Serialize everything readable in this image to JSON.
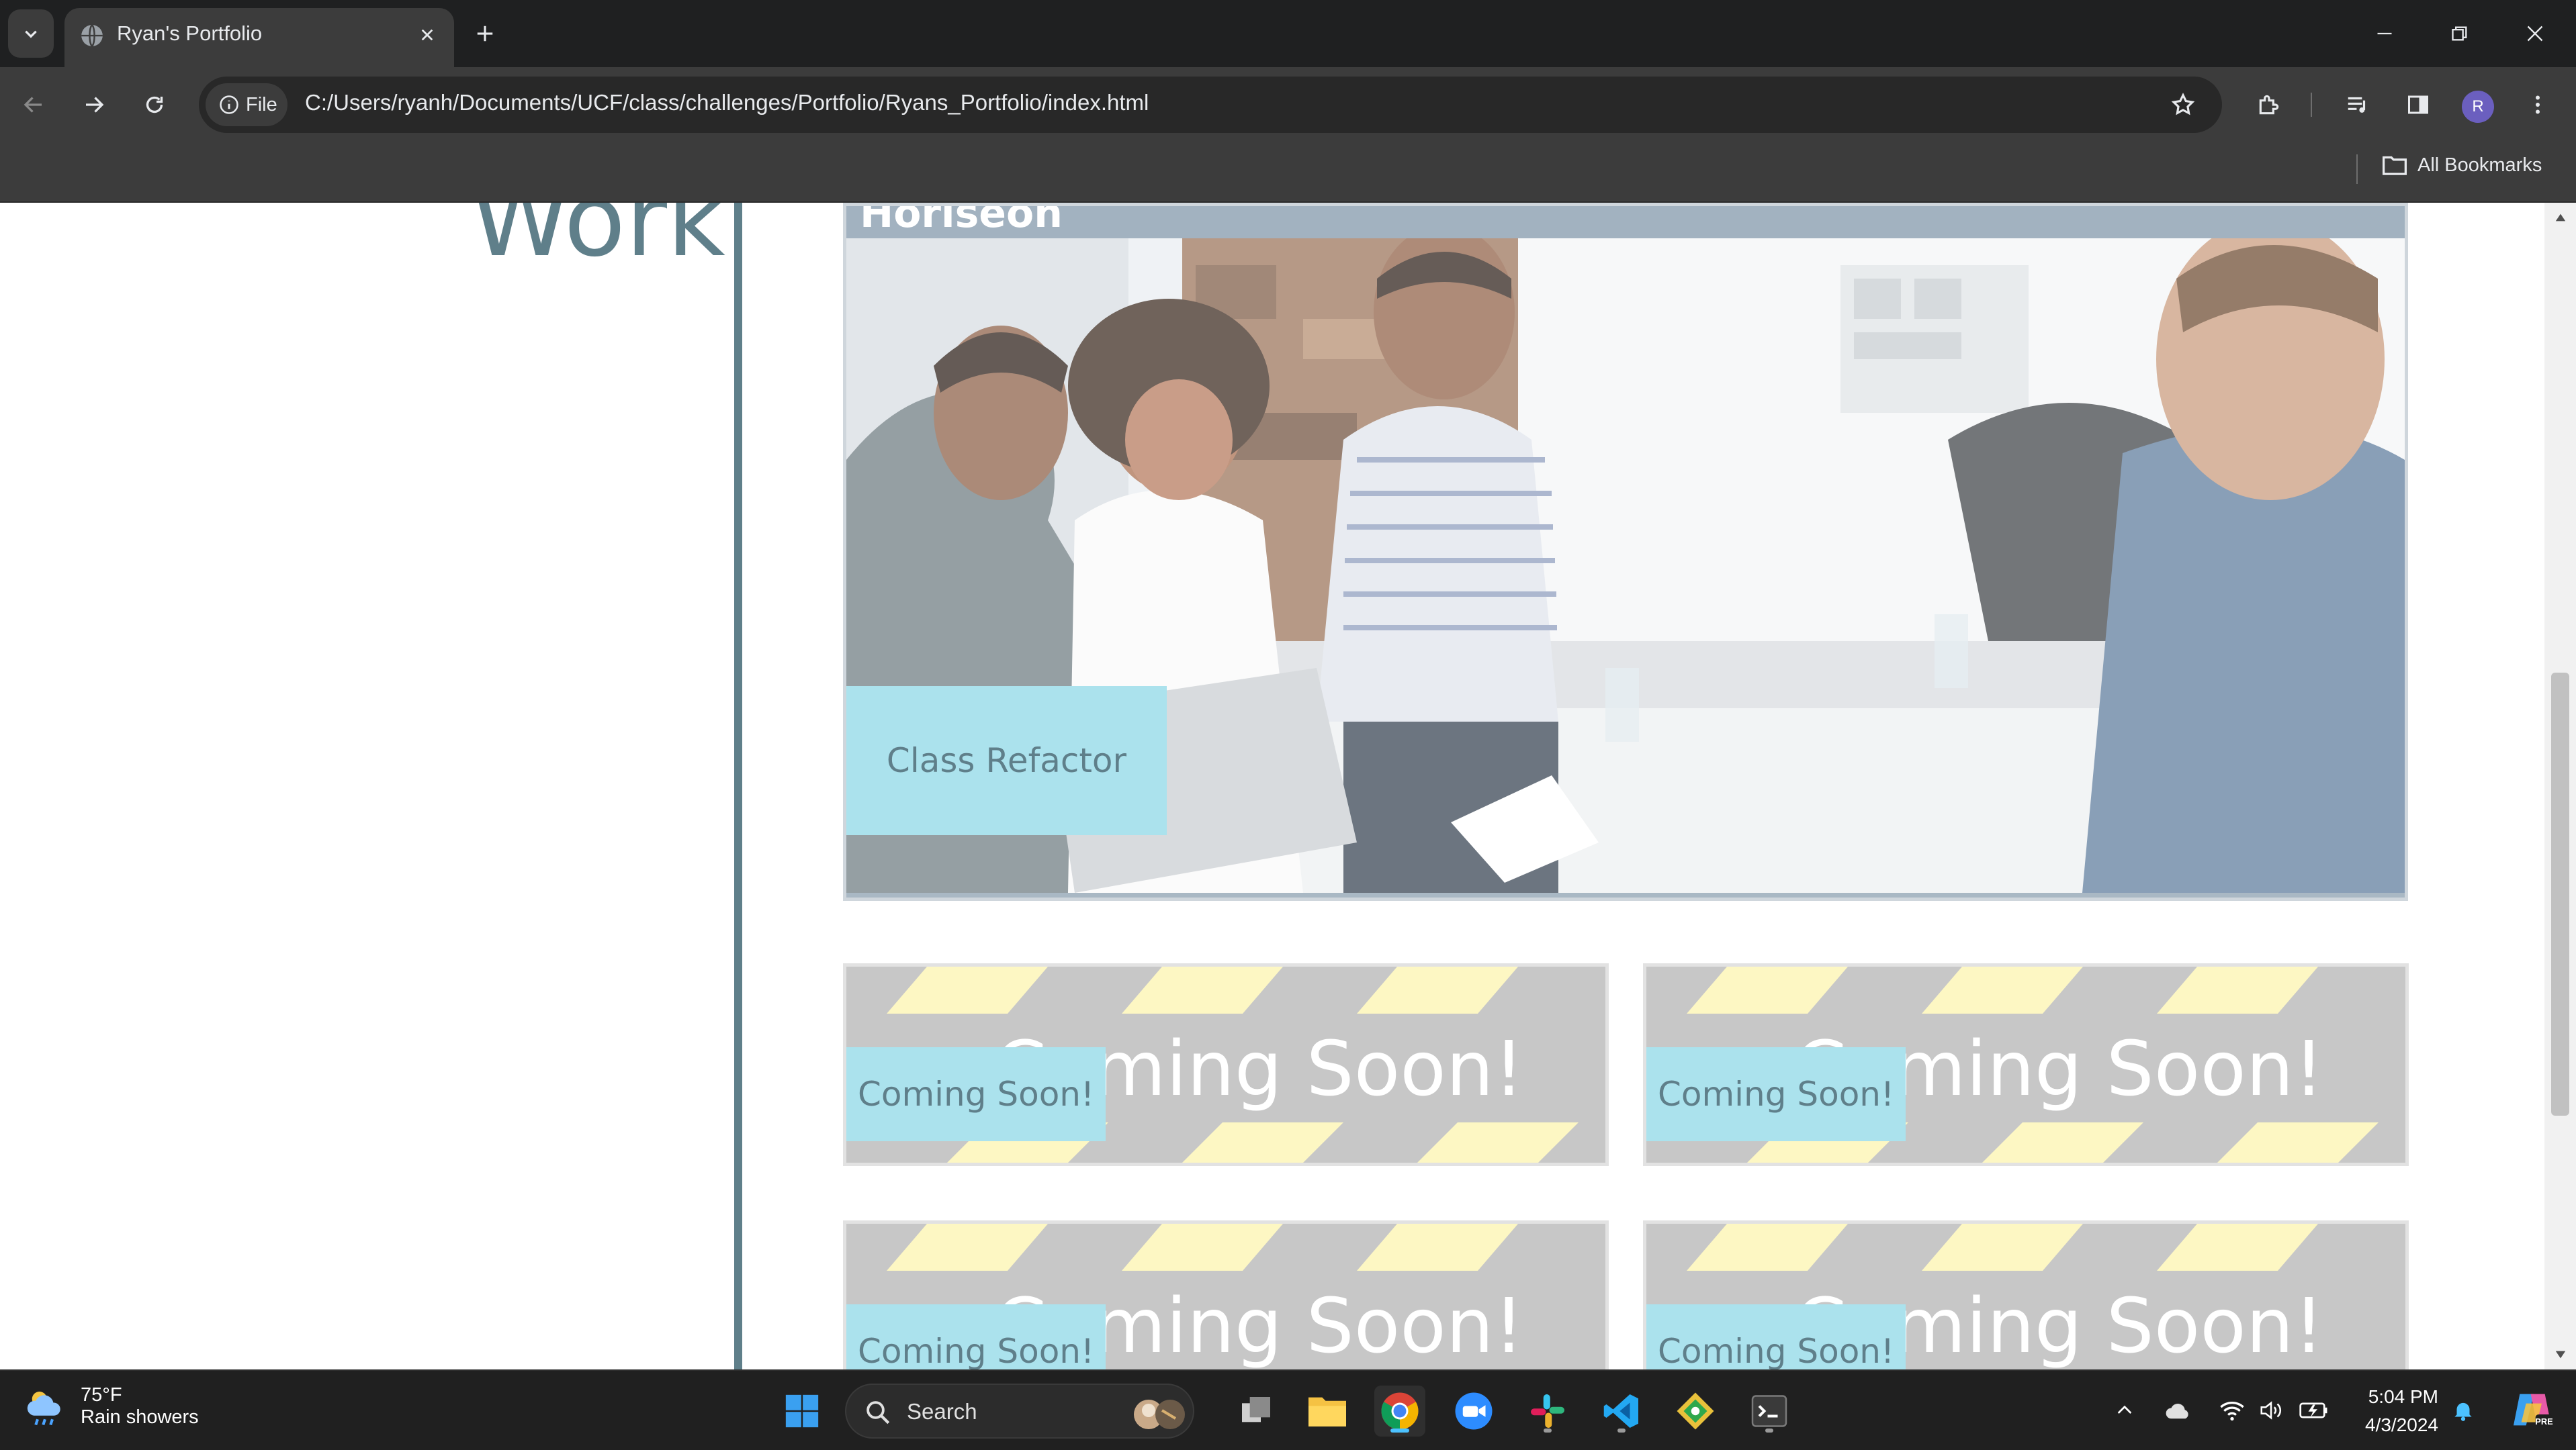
{
  "browser": {
    "tab_title": "Ryan's Portfolio",
    "address_chip": "File",
    "url": "C:/Users/ryanh/Documents/UCF/class/challenges/Portfolio/Ryans_Portfolio/index.html",
    "bookmarks_label": "All Bookmarks",
    "profile_initial": "R"
  },
  "page": {
    "section_heading": "Work",
    "featured_project": {
      "header_text": "Horiseon",
      "label": "Class Refactor"
    },
    "coming_soon_cards": [
      {
        "image_text": "Coming Soon!",
        "label": "Coming Soon!"
      },
      {
        "image_text": "Coming Soon!",
        "label": "Coming Soon!"
      },
      {
        "image_text": "Coming Soon!",
        "label": "Coming Soon!"
      },
      {
        "image_text": "Coming Soon!",
        "label": "Coming Soon!"
      }
    ]
  },
  "taskbar": {
    "weather_temp": "75°F",
    "weather_condition": "Rain showers",
    "search_placeholder": "Search",
    "time": "5:04 PM",
    "date": "4/3/2024"
  },
  "colors": {
    "accent_slate": "#5f7f8a",
    "label_bg": "#abe2ed",
    "stripe_yellow": "#fdf7c3",
    "card_gray": "#c7c7c7"
  }
}
